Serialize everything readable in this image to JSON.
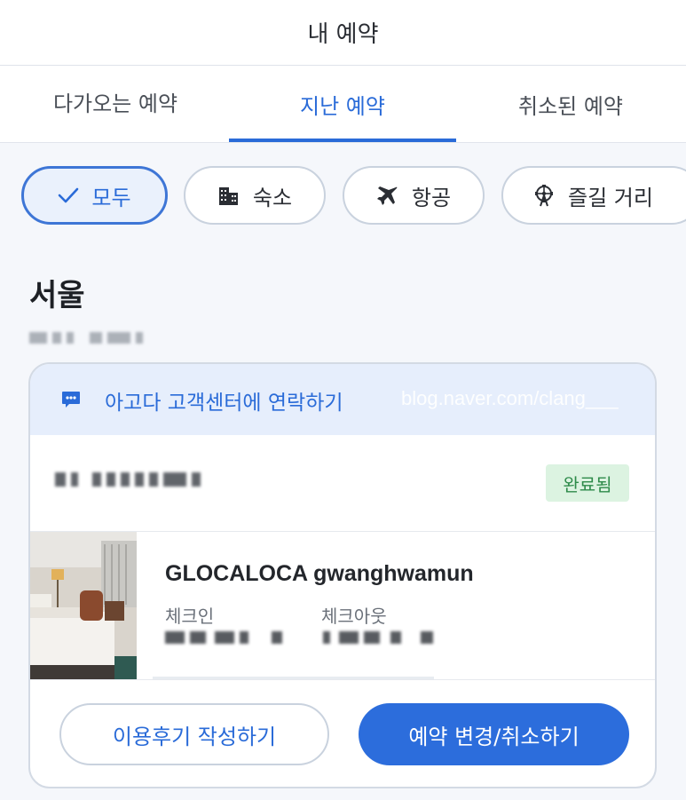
{
  "header": {
    "title": "내 예약"
  },
  "tabs": [
    {
      "label": "다가오는 예약"
    },
    {
      "label": "지난 예약",
      "active": true
    },
    {
      "label": "취소된 예약"
    }
  ],
  "filters": [
    {
      "label": "모두",
      "icon": "check-icon",
      "selected": true
    },
    {
      "label": "숙소",
      "icon": "building-icon"
    },
    {
      "label": "항공",
      "icon": "airplane-icon"
    },
    {
      "label": "즐길 거리",
      "icon": "ferris-wheel-icon"
    }
  ],
  "section": {
    "city": "서울"
  },
  "card": {
    "support_label": "아고다 고객센터에 연락하기",
    "support_icon": "chat-bubble-icon",
    "watermark": "blog.naver.com/clang___",
    "status": "완료됨",
    "hotel_name": "GLOCALOCA gwanghwamun",
    "checkin_label": "체크인",
    "checkout_label": "체크아웃",
    "review_button": "이용후기 작성하기",
    "change_button": "예약 변경/취소하기"
  },
  "colors": {
    "accent": "#2a6bd8",
    "primary_button": "#2c6ddc",
    "status_bg": "#dcf3e1",
    "status_text": "#2e8b4a",
    "support_bg": "#e6eefc"
  }
}
